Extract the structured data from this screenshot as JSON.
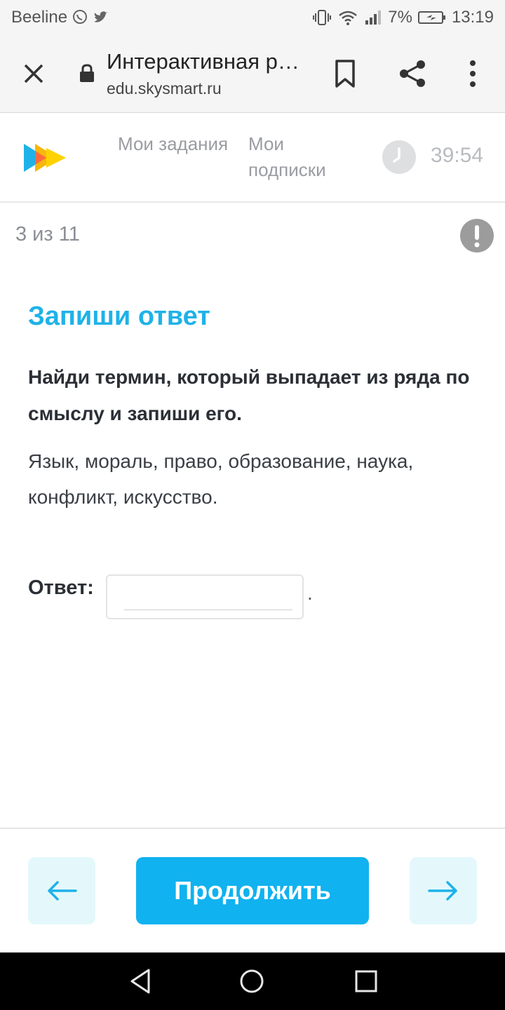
{
  "status_bar": {
    "carrier": "Beeline",
    "battery": "7%",
    "time": "13:19"
  },
  "browser": {
    "title": "Интерактивная р…",
    "url": "edu.skysmart.ru"
  },
  "header": {
    "nav": [
      "Мои задания",
      "Мои подписки"
    ],
    "timer": "39:54"
  },
  "task": {
    "progress": "3 из 11",
    "title": "Запиши ответ",
    "question": "Найди термин, который выпадает из ряда по смыслу и запиши его.",
    "terms": "Язык, мораль, право, образование, наука, конфликт, искусство.",
    "answer_label": "Ответ:",
    "answer_value": "",
    "answer_suffix": "."
  },
  "footer": {
    "continue_label": "Продолжить"
  },
  "colors": {
    "accent": "#10b2ef",
    "title": "#1fb2e8",
    "arrow_bg": "#e4f8fc"
  }
}
